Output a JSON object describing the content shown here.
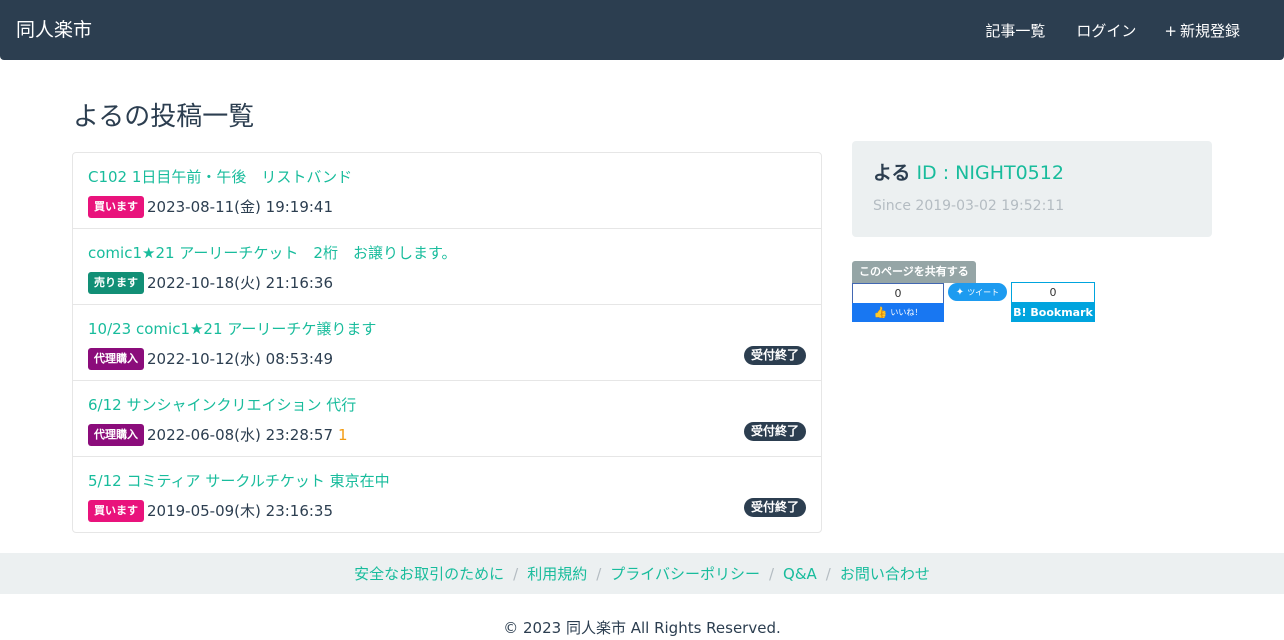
{
  "nav": {
    "brand": "同人楽市",
    "links": [
      {
        "icon": "",
        "label": "記事一覧"
      },
      {
        "icon": "",
        "label": "ログイン"
      },
      {
        "icon": "+",
        "label": "新規登録"
      }
    ]
  },
  "page": {
    "title": "よるの投稿一覧"
  },
  "posts": [
    {
      "title": "C102 1日目午前・午後　リストバンド",
      "type": "買います",
      "date": "2023-08-11(金) 19:19:41",
      "count": "",
      "closed": ""
    },
    {
      "title": "comic1★21 アーリーチケット　2桁　お譲りします。",
      "type": "売ります",
      "date": "2022-10-18(火) 21:16:36",
      "count": "",
      "closed": ""
    },
    {
      "title": "10/23 comic1★21 アーリーチケ譲ります",
      "type": "代理購入",
      "date": "2022-10-12(水) 08:53:49",
      "count": "",
      "closed": "受付終了"
    },
    {
      "title": "6/12 サンシャインクリエイション 代行",
      "type": "代理購入",
      "date": "2022-06-08(水) 23:28:57",
      "count": "1",
      "closed": "受付終了"
    },
    {
      "title": "5/12 コミティア サークルチケット 東京在中",
      "type": "買います",
      "date": "2019-05-09(木) 23:16:35",
      "count": "",
      "closed": "受付終了"
    }
  ],
  "profile": {
    "icon": "",
    "name": "よる",
    "id": "ID : NIGHT0512",
    "since_icon": "",
    "since": "Since 2019-03-02 19:52:11"
  },
  "share": {
    "label": "このページを共有する",
    "facebook_count": "0",
    "facebook_label": "いいね！",
    "twitter_label": "ツイート",
    "hatena_count": "0",
    "hatena_label": "B! Bookmark"
  },
  "footer": {
    "links": [
      "安全なお取引のために",
      "利用規約",
      "プライバシーポリシー",
      "Q&A",
      "お問い合わせ"
    ],
    "copyright": "© 2023 同人楽市 All Rights Reserved."
  },
  "colors": {
    "navbar": "#2c3e50",
    "accent": "#18bc9c",
    "buy": "#e9137c",
    "sell": "#128f76",
    "proxy": "#8b0c7b",
    "count": "#f39c12"
  }
}
